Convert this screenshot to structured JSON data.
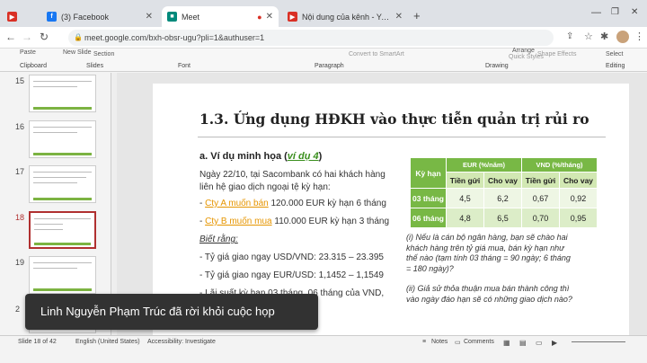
{
  "browser": {
    "tabs": [
      {
        "label": "",
        "color": "#d93025"
      },
      {
        "label": "(3) Facebook",
        "color": "#1877f2"
      },
      {
        "label": "Meet",
        "color": "#00897b"
      },
      {
        "label": "",
        "color": "#d93025"
      },
      {
        "label": "Nội dung của kênh - YouTube Stu",
        "color": "#d93025"
      }
    ],
    "url": "meet.google.com/bxh-obsr-ugu?pli=1&authuser=1",
    "new_tab": "+"
  },
  "ribbon": {
    "paste": "Paste",
    "new_slide": "New Slide",
    "layout_label": "Section",
    "convert": "Convert to SmartArt",
    "arrange": "Arrange",
    "quick_styles": "Quick Styles",
    "shape_effects": "Shape Effects",
    "select": "Select",
    "groups": {
      "clipboard": "Clipboard",
      "slides": "Slides",
      "font": "Font",
      "paragraph": "Paragraph",
      "drawing": "Drawing",
      "editing": "Editing"
    }
  },
  "thumbnails": [
    {
      "num": "15",
      "selected": false
    },
    {
      "num": "16",
      "selected": false
    },
    {
      "num": "17",
      "selected": false
    },
    {
      "num": "18",
      "selected": true
    },
    {
      "num": "19",
      "selected": false
    },
    {
      "num": "2",
      "selected": false
    }
  ],
  "slide": {
    "title": "1.3. Ứng dụng HĐKH vào thực tiễn quản trị rủi ro",
    "heading_prefix": "a. Ví dụ minh họa (",
    "heading_link": "ví dụ 4",
    "heading_suffix": ")",
    "intro1": "Ngày 22/10, tại Sacombank có hai khách hàng",
    "intro2": "liên hệ giao dịch ngoại tệ kỳ hạn:",
    "item1_pre": "- ",
    "item1_orange": "Cty A muốn bán",
    "item1_post": " 120.000 EUR kỳ hạn 6 tháng",
    "item2_pre": "- ",
    "item2_orange": "Cty B muốn mua",
    "item2_post": " 110.000 EUR kỳ hạn 3 tháng",
    "known": "Biết rằng:",
    "rate1": "- Tỷ giá giao ngay USD/VND: 23.315 – 23.395",
    "rate2": "- Tỷ giá giao ngay EUR/USD: 1,1452 – 1,1549",
    "rate3": "- Lãi suất kỳ hạn 03 tháng, 06 tháng của VND,",
    "q1_l1": "(i) Nếu là cán bộ ngân hàng, bạn sẽ chào hai",
    "q1_l2": "khách hàng trên tỷ giá mua, bán kỳ hạn như",
    "q1_l3": "thế nào (tạm tính 03 tháng = 90 ngày; 6 tháng",
    "q1_l4": "= 180 ngày)?",
    "q2_l1": "(ii) Giả sử thỏa thuận mua bán thành công thì",
    "q2_l2": "vào ngày đáo hạn sẽ có những giao dịch nào?"
  },
  "table": {
    "corner": "Kỳ hạn",
    "group1": "EUR (%/năm)",
    "group2": "VND (%/tháng)",
    "sub": [
      "Tiền gửi",
      "Cho vay",
      "Tiền gửi",
      "Cho vay"
    ],
    "rows": [
      {
        "label": "03 tháng",
        "values": [
          "4,5",
          "6,2",
          "0,67",
          "0,92"
        ]
      },
      {
        "label": "06 tháng",
        "values": [
          "4,8",
          "6,5",
          "0,70",
          "0,95"
        ]
      }
    ]
  },
  "status": {
    "slide": "Slide 18 of 42",
    "language": "English (United States)",
    "accessibility": "Accessibility: Investigate",
    "notes": "Notes",
    "comments": "Comments"
  },
  "toast": "Linh Nguyễn Phạm Trúc đã rời khỏi cuộc họp"
}
